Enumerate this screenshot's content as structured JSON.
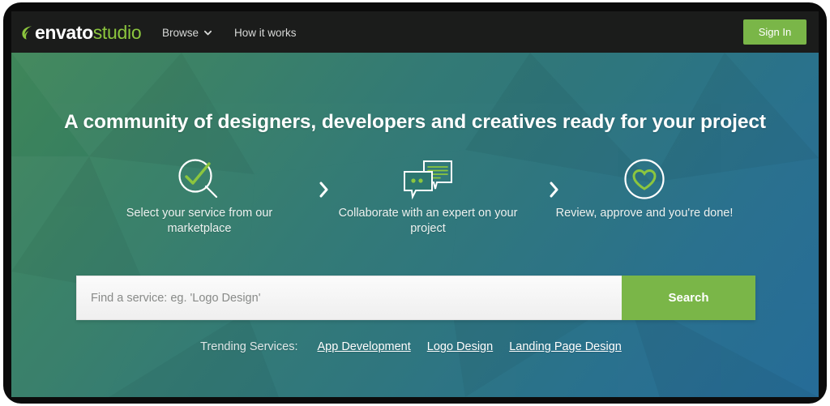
{
  "nav": {
    "logo": {
      "icon": "leaf-icon",
      "primary": "envato",
      "secondary": "studio"
    },
    "links": [
      {
        "label": "Browse",
        "icon": "chevron-down-icon"
      },
      {
        "label": "How it works",
        "icon": null
      }
    ],
    "signin_label": "Sign In"
  },
  "hero": {
    "headline": "A community of designers, developers and creatives ready for your project",
    "steps": [
      {
        "icon": "magnifier-check-icon",
        "label": "Select your service from our marketplace"
      },
      {
        "icon": "chat-bubbles-icon",
        "label": "Collaborate with an expert on your project"
      },
      {
        "icon": "heart-circle-icon",
        "label": "Review, approve and you're done!"
      }
    ],
    "separator_icon": "chevron-right-icon",
    "search": {
      "value": "",
      "placeholder": "Find a service: eg. 'Logo Design'",
      "button_label": "Search"
    },
    "trending": {
      "label": "Trending Services:",
      "links": [
        "App Development",
        "Logo Design",
        "Landing Page Design"
      ]
    }
  },
  "colors": {
    "navbar_bg": "#1b1c1b",
    "accent_green": "#7ab648",
    "logo_green": "#8cc63e",
    "icon_green": "#8cc63e",
    "gradient_start": "#3f8659",
    "gradient_mid": "#2c7670",
    "gradient_end": "#1f6795",
    "frame": "#0b0b0b"
  }
}
